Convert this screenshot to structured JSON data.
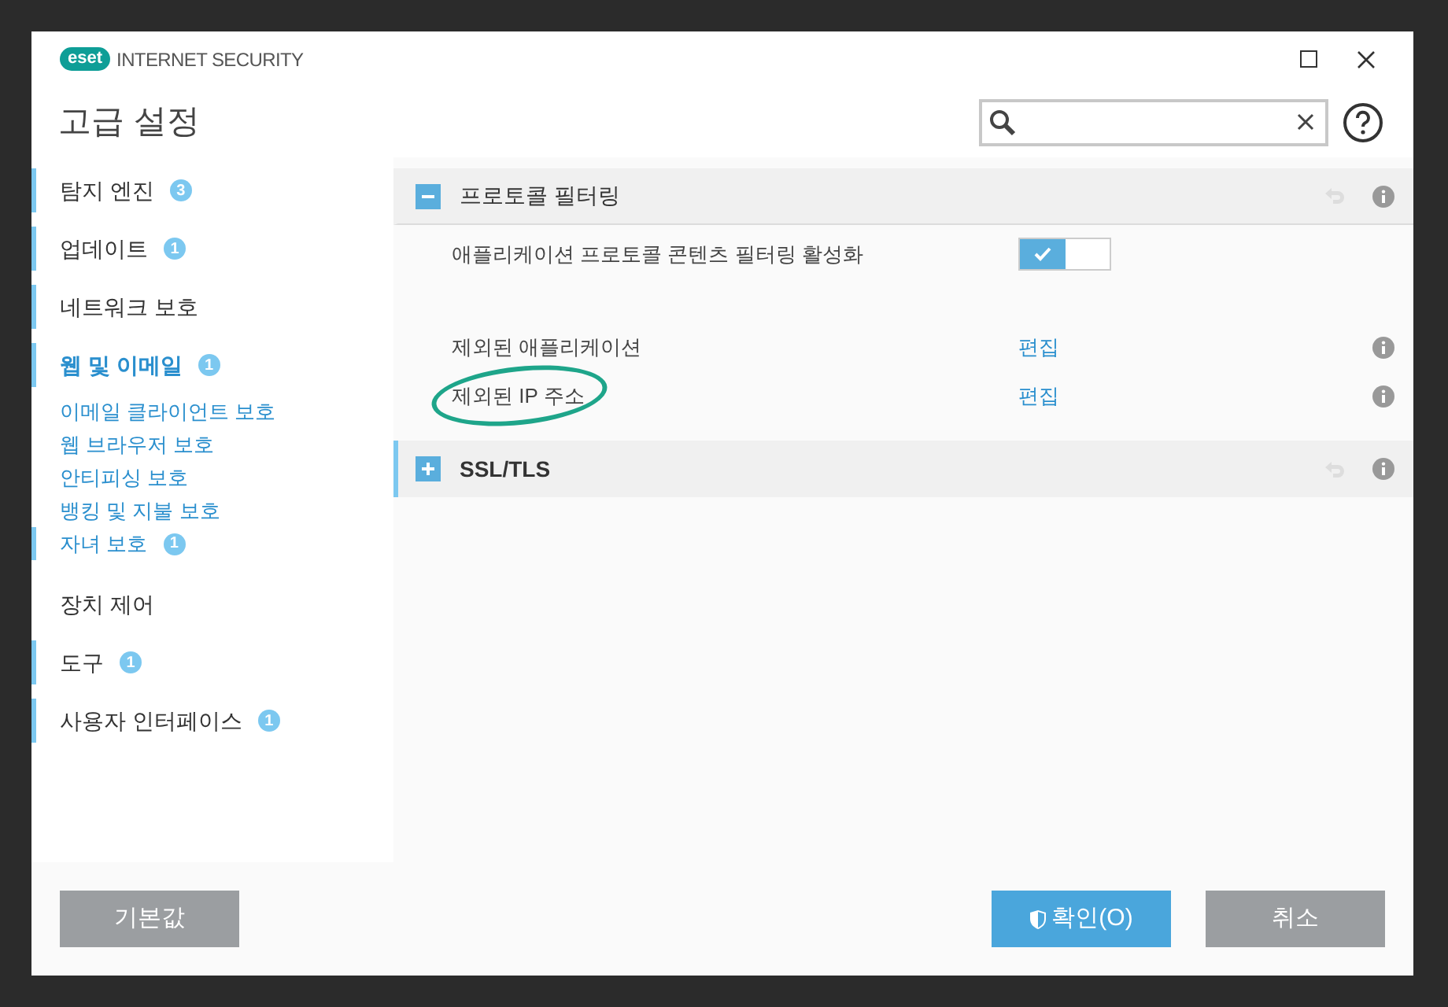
{
  "window": {
    "logo_text": "eset",
    "product": "INTERNET SECURITY"
  },
  "header": {
    "title": "고급 설정"
  },
  "sidebar": {
    "items": [
      {
        "label": "탐지 엔진",
        "badge": "3",
        "marked": true,
        "selected": false
      },
      {
        "label": "업데이트",
        "badge": "1",
        "marked": true,
        "selected": false
      },
      {
        "label": "네트워크 보호",
        "marked": true,
        "selected": false
      },
      {
        "label": "웹 및 이메일",
        "badge": "1",
        "marked": true,
        "selected": true,
        "children": [
          {
            "label": "이메일 클라이언트 보호",
            "marked": false
          },
          {
            "label": "웹 브라우저 보호",
            "marked": false
          },
          {
            "label": "안티피싱 보호",
            "marked": false
          },
          {
            "label": "뱅킹 및 지불 보호",
            "marked": false
          },
          {
            "label": "자녀 보호",
            "badge": "1",
            "marked": true
          }
        ]
      },
      {
        "label": "장치 제어",
        "marked": false,
        "selected": false
      },
      {
        "label": "도구",
        "badge": "1",
        "marked": true,
        "selected": false
      },
      {
        "label": "사용자 인터페이스",
        "badge": "1",
        "marked": true,
        "selected": false
      }
    ]
  },
  "sections": [
    {
      "title": "프로토콜 필터링",
      "expanded": true,
      "marked": false,
      "rows": [
        {
          "kind": "toggle",
          "label": "애플리케이션 프로토콜 콘텐츠 필터링 활성화",
          "on": true
        },
        {
          "kind": "link",
          "label": "제외된 애플리케이션",
          "link": "편집",
          "circled": false
        },
        {
          "kind": "link",
          "label": "제외된 IP 주소",
          "link": "편집",
          "circled": true
        }
      ]
    },
    {
      "title": "SSL/TLS",
      "expanded": false,
      "marked": true
    }
  ],
  "footer": {
    "default_button": "기본값",
    "ok_button": "확인(O)",
    "cancel_button": "취소"
  }
}
